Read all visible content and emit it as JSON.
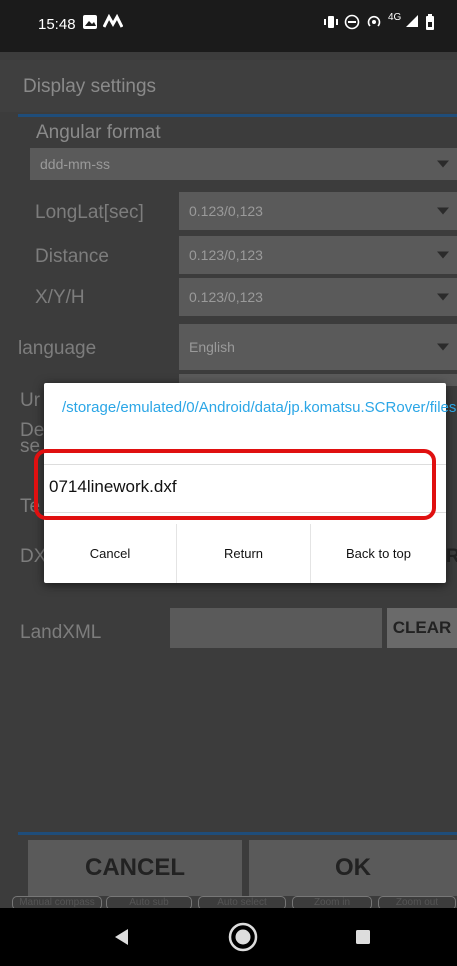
{
  "status_bar": {
    "time": "15:48",
    "icons_left": [
      "image-icon",
      "signal-m-icon"
    ],
    "icons_right": [
      "vibrate-icon",
      "dnd-icon",
      "hotspot-icon",
      "network-4g-icon",
      "signal-icon",
      "battery-icon"
    ],
    "network_label": "4G"
  },
  "background_screen": {
    "title": "Display settings",
    "angular_format": {
      "label": "Angular format",
      "value": "ddd-mm-ss"
    },
    "rows": [
      {
        "label": "LongLat[sec]",
        "value": "0.123/0,123"
      },
      {
        "label": "Distance",
        "value": "0.123/0,123"
      },
      {
        "label": "X/Y/H",
        "value": "0.123/0,123"
      },
      {
        "label": "language",
        "value": "English"
      }
    ],
    "partial_labels": [
      "Ur",
      "De",
      "se",
      "Te",
      "DX"
    ],
    "partial_right": "R",
    "landxml": {
      "label": "LandXML",
      "clear_label": "CLEAR"
    },
    "cancel_label": "CANCEL",
    "ok_label": "OK",
    "bottom_tabs": [
      "Manual compass",
      "Auto sub",
      "Auto select",
      "Zoom in",
      "Zoom out"
    ]
  },
  "dialog": {
    "path": "/storage/emulated/0/Android/data/jp.komatsu.SCRover/files",
    "file_name": "0714linework.dxf",
    "buttons": {
      "cancel": "Cancel",
      "return": "Return",
      "back_to_top": "Back to top"
    },
    "highlight_color": "#e01010"
  },
  "nav_bar": {
    "back": "back-icon",
    "home": "home-icon",
    "recents": "recents-icon"
  }
}
